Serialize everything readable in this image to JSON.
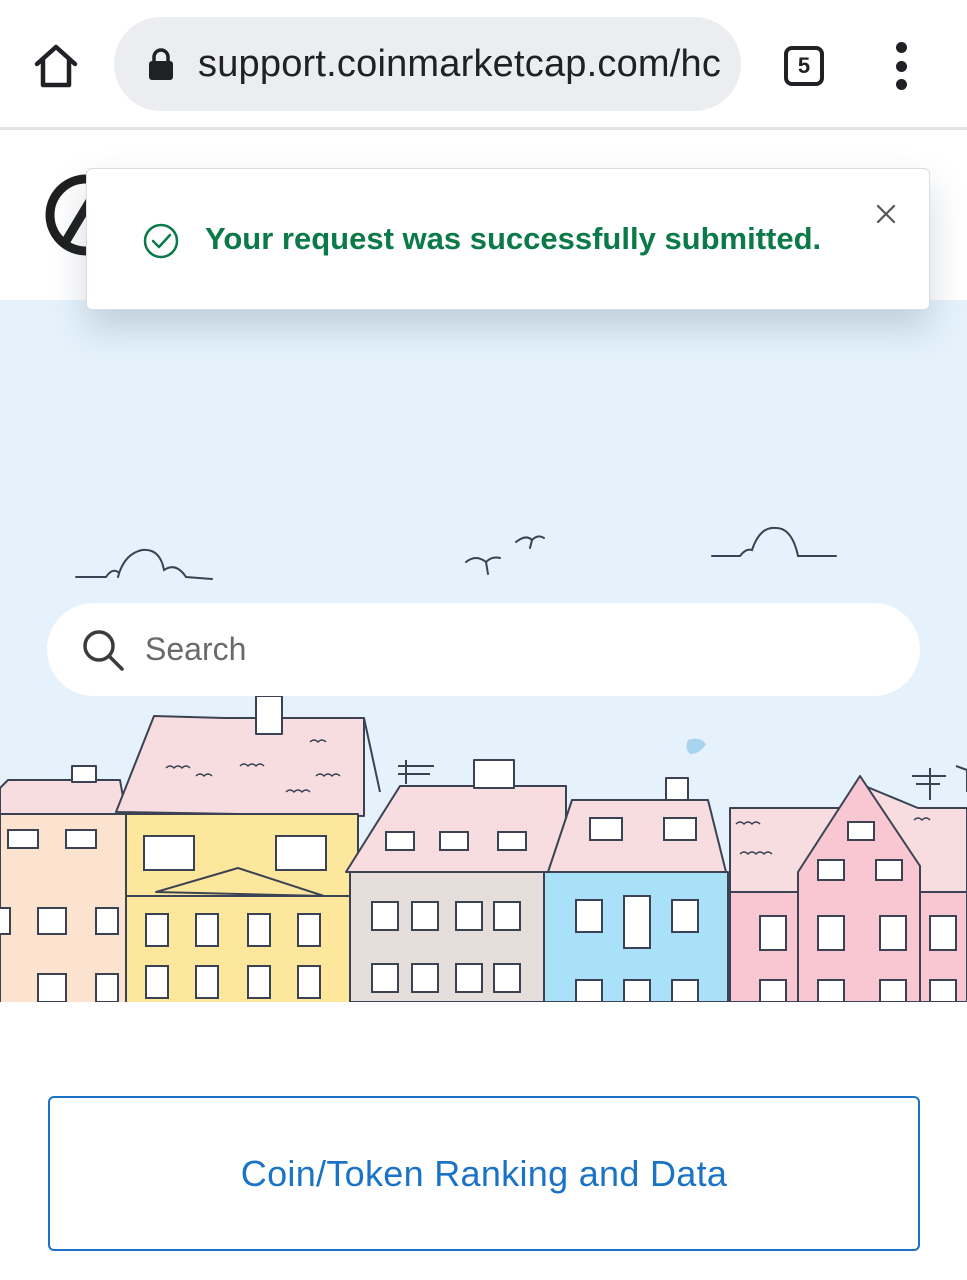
{
  "browser": {
    "url": "support.coinmarketcap.com/hc",
    "tab_count": "5",
    "icons": {
      "home": "home-icon",
      "lock": "lock-icon",
      "tabs": "tabs-icon",
      "menu": "more-vertical-icon"
    }
  },
  "toast": {
    "message": "Your request was successfully submitted.",
    "status_color": "#0b7a48",
    "icons": {
      "status": "check-circle-icon",
      "close": "close-icon"
    }
  },
  "hero": {
    "search_placeholder": "Search",
    "background_color": "#e5f2fc"
  },
  "categories": [
    {
      "label": "Coin/Token Ranking and Data"
    }
  ],
  "colors": {
    "accent": "#1a73c7",
    "success": "#0b7a48"
  }
}
